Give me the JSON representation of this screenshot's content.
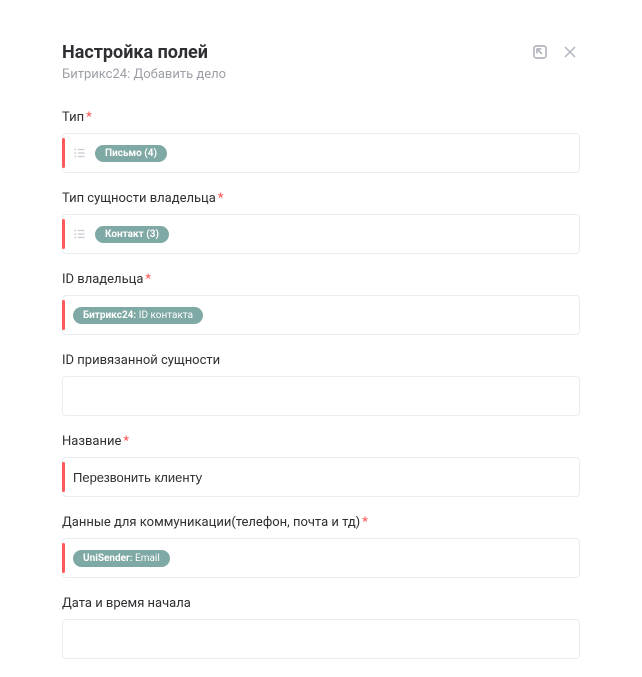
{
  "header": {
    "title": "Настройка полей",
    "subtitle": "Битрикс24: Добавить дело"
  },
  "fields": {
    "type": {
      "label": "Тип",
      "pill": "Письмо (4)"
    },
    "ownerEntityType": {
      "label": "Тип сущности владельца",
      "pill": "Контакт (3)"
    },
    "ownerId": {
      "label": "ID владельца",
      "pill_prefix": "Битрикс24:",
      "pill_suffix": "ID контакта"
    },
    "linkedEntityId": {
      "label": "ID привязанной сущности",
      "value": ""
    },
    "title": {
      "label": "Название",
      "value": "Перезвонить клиенту"
    },
    "commData": {
      "label": "Данные для коммуникации(телефон, почта и тд)",
      "pill_prefix": "UniSender:",
      "pill_suffix": "Email"
    },
    "startDatetime": {
      "label": "Дата и время начала",
      "value": ""
    }
  }
}
